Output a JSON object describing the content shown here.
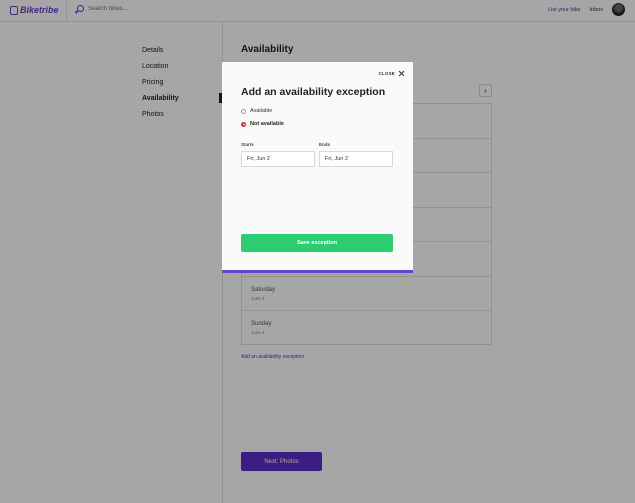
{
  "header": {
    "logo_text": "Biketribe",
    "search_placeholder": "Search bikes...",
    "list_bike_label": "List your bike",
    "inbox_label": "Inbox"
  },
  "sidebar": {
    "items": [
      {
        "label": "Details"
      },
      {
        "label": "Location"
      },
      {
        "label": "Pricing"
      },
      {
        "label": "Availability"
      },
      {
        "label": "Photos"
      }
    ]
  },
  "main": {
    "title": "Availability",
    "next_week_arrow": "›",
    "days": [
      {
        "name": "",
        "date": ""
      },
      {
        "name": "",
        "date": ""
      },
      {
        "name": "",
        "date": ""
      },
      {
        "name": "",
        "date": ""
      },
      {
        "name": "",
        "date": ""
      },
      {
        "name": "Saturday",
        "date": "June 3"
      },
      {
        "name": "Sunday",
        "date": "June 4"
      }
    ],
    "add_exception_link": "Add an availability exception",
    "next_button": "Next: Photos"
  },
  "modal": {
    "close_label": "CLOSE",
    "title": "Add an availability exception",
    "options": [
      {
        "label": "Available",
        "checked": false
      },
      {
        "label": "Not available",
        "checked": true
      }
    ],
    "starts_label": "Starts",
    "starts_value": "Fri, Jun 2",
    "ends_label": "Ends",
    "ends_value": "Fri, Jun 2",
    "save_label": "Save exception"
  },
  "colors": {
    "brand_purple": "#6b3fd1",
    "save_green": "#2ecc71",
    "radio_red": "#e0283d"
  }
}
